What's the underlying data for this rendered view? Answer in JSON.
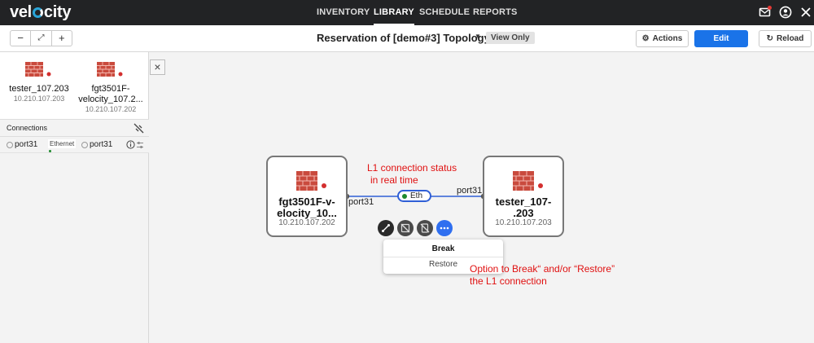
{
  "app": {
    "logo_left": "vel",
    "logo_right": "city",
    "nav": [
      {
        "label": "INVENTORY",
        "active": false
      },
      {
        "label": "LIBRARY",
        "active": true
      },
      {
        "label": "SCHEDULE",
        "active": false
      },
      {
        "label": "REPORTS",
        "active": false
      }
    ],
    "top_icons": [
      "mail-icon",
      "user-icon",
      "close-icon"
    ],
    "notification_color": "#e53935"
  },
  "toolbar": {
    "zoom_out": "−",
    "fit": "⤢",
    "zoom_in": "+",
    "title": "Reservation of [demo#3] Topology 1",
    "view_only": "View Only",
    "actions_label": "Actions",
    "edit_label": "Edit",
    "reload_label": "Reload",
    "accent": "#1a73e8"
  },
  "sidebar": {
    "devices": [
      {
        "name_line1": "tester_107.203",
        "name_line2": "",
        "ip": "10.210.107.203"
      },
      {
        "name_line1": "fgt3501F-",
        "name_line2": "velocity_107.2...",
        "ip": "10.210.107.202"
      }
    ],
    "connections_label": "Connections",
    "connection": {
      "port_a": "port31",
      "type": "Ethernet",
      "port_b": "port31"
    }
  },
  "canvas": {
    "left_node": {
      "name_line1": "fgt3501F-v-",
      "name_line2": "elocity_10...",
      "ip": "10.210.107.202",
      "port": "port31"
    },
    "right_node": {
      "name_line1": "tester_107-",
      "name_line2": ".203",
      "ip": "10.210.107.203",
      "port": "port31"
    },
    "link_label": "Eth",
    "link_status_color": "#1e8a2e",
    "menu": {
      "break_label": "Break",
      "restore_label": "Restore"
    },
    "annotations": {
      "status_line1": "L1 connection status",
      "status_line2": "in real time",
      "option_line1": "Option to Break“ and/or “Restore”",
      "option_line2": "the L1 connection"
    }
  }
}
